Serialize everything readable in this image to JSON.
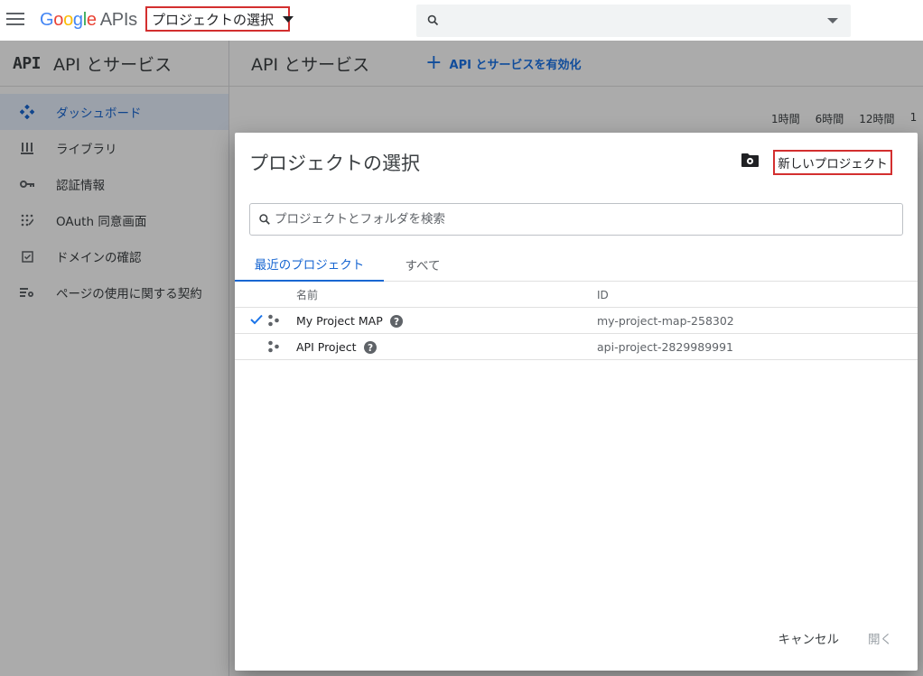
{
  "topbar": {
    "logo": {
      "letters": [
        {
          "ch": "G",
          "color": "#4285F4"
        },
        {
          "ch": "o",
          "color": "#EA4335"
        },
        {
          "ch": "o",
          "color": "#FBBC05"
        },
        {
          "ch": "g",
          "color": "#4285F4"
        },
        {
          "ch": "l",
          "color": "#34A853"
        },
        {
          "ch": "e",
          "color": "#EA4335"
        }
      ],
      "suffix": "APIs"
    },
    "project_picker_label": "プロジェクトの選択",
    "search_icon": "search-icon"
  },
  "sidebar": {
    "badge": "API",
    "title": "API とサービス",
    "items": [
      {
        "label": "ダッシュボード",
        "icon": "dashboard-icon",
        "active": true
      },
      {
        "label": "ライブラリ",
        "icon": "library-icon",
        "active": false
      },
      {
        "label": "認証情報",
        "icon": "key-icon",
        "active": false
      },
      {
        "label": "OAuth 同意画面",
        "icon": "consent-icon",
        "active": false
      },
      {
        "label": "ドメインの確認",
        "icon": "checkbox-icon",
        "active": false
      },
      {
        "label": "ページの使用に関する契約",
        "icon": "settings-list-icon",
        "active": false
      }
    ]
  },
  "main": {
    "title": "API とサービス",
    "enable_link": "API とサービスを有効化",
    "time_filters": [
      "1時間",
      "6時間",
      "12時間",
      "1"
    ]
  },
  "dialog": {
    "title": "プロジェクトの選択",
    "new_project_label": "新しいプロジェクト",
    "search_placeholder": "プロジェクトとフォルダを検索",
    "tabs": {
      "recent": "最近のプロジェクト",
      "all": "すべて"
    },
    "columns": {
      "name": "名前",
      "id": "ID"
    },
    "rows": [
      {
        "name": "My Project MAP",
        "id": "my-project-map-258302",
        "selected": true
      },
      {
        "name": "API Project",
        "id": "api-project-2829989991",
        "selected": false
      }
    ],
    "cancel_label": "キャンセル",
    "open_label": "開く"
  },
  "colors": {
    "accent": "#1a73e8",
    "highlight_box": "#d32f2f",
    "active_bg": "#e8f0fe"
  }
}
